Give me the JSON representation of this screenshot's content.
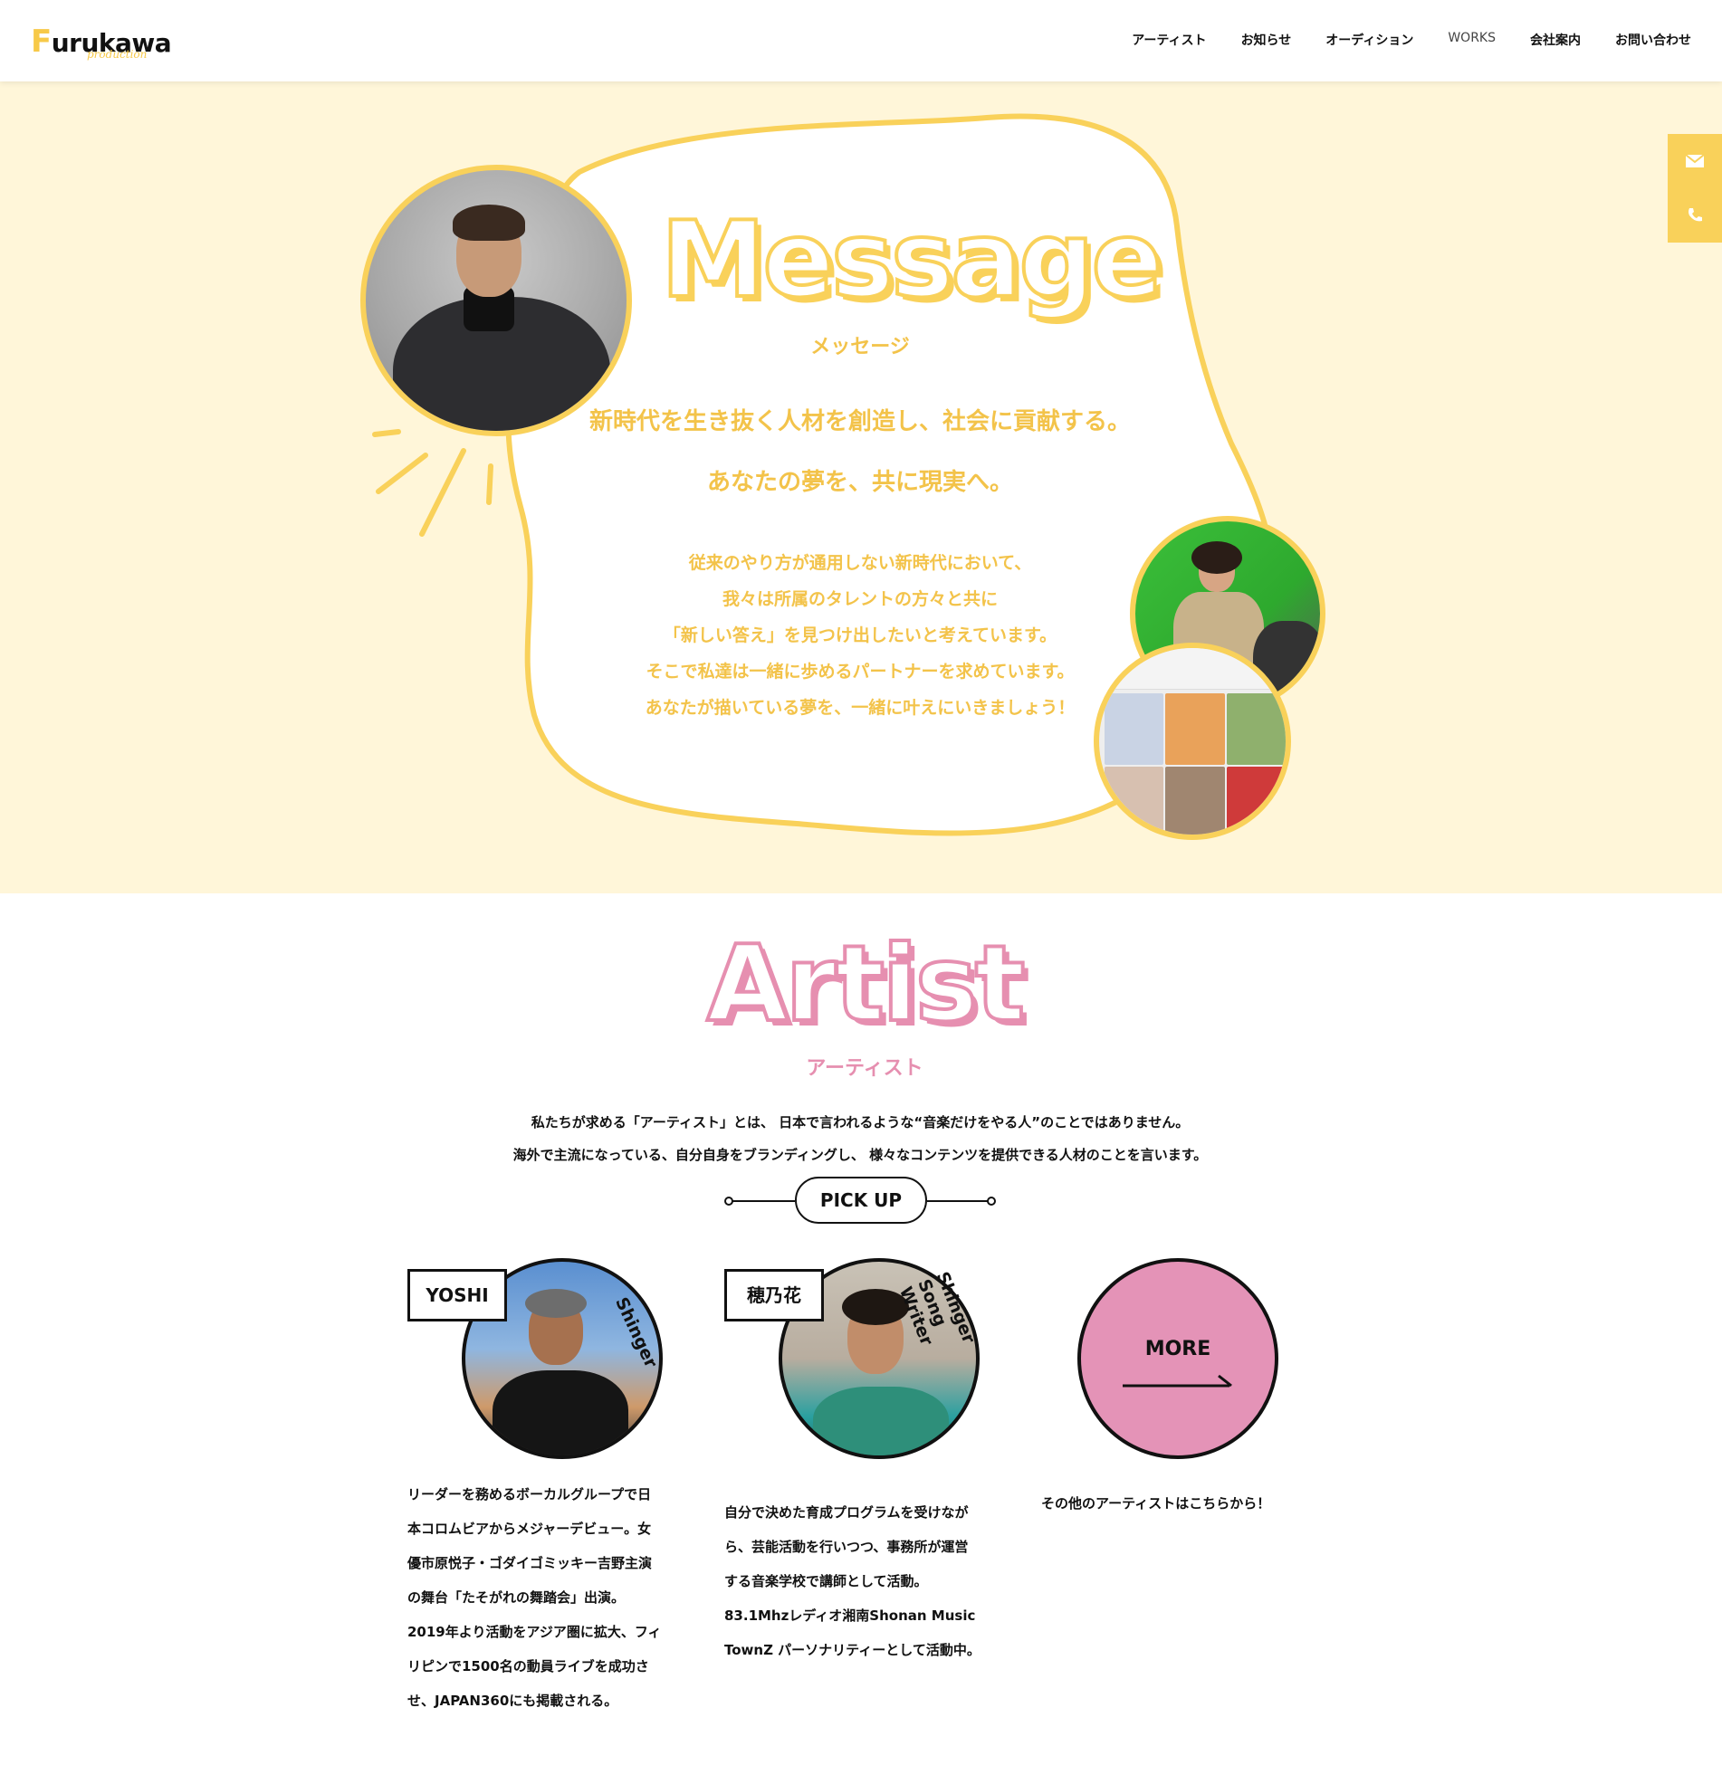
{
  "header": {
    "logo_main": "urukawa",
    "logo_first": "F",
    "logo_sub": "production",
    "nav": [
      "アーティスト",
      "お知らせ",
      "オーディション",
      "WORKS",
      "会社案内",
      "お問い合わせ"
    ]
  },
  "side_tab": {
    "icons": [
      "mail-icon",
      "phone-icon"
    ]
  },
  "message": {
    "title": "Message",
    "subtitle": "メッセージ",
    "lead1": "新時代を生き抜く人材を創造し、社会に貢献する。",
    "lead2": "あなたの夢を、共に現実へ。",
    "body": [
      "従来のやり方が通用しない新時代において、",
      "我々は所属のタレントの方々と共に",
      "「新しい答え」を見つけ出したいと考えています。",
      "そこで私達は一緒に歩めるパートナーを求めています。",
      "あなたが描いている夢を、一緒に叶えにいきましょう！"
    ]
  },
  "artist": {
    "title": "Artist",
    "subtitle": "アーティスト",
    "intro": [
      "私たちが求める「アーティスト」とは、 日本で言われるような“音楽だけをやる人”のことではありません。",
      "海外で主流になっている、自分自身をブランディングし、 様々なコンテンツを提供できる人材のことを言います。"
    ],
    "pickup": "PICK UP",
    "cards": [
      {
        "name": "YOSHI",
        "role": "Shinger",
        "desc": [
          "リーダーを務めるボーカルグループで日",
          "本コロムビアからメジャーデビュー。女",
          "優市原悦子・ゴダイゴミッキー吉野主演",
          "の舞台「たそがれの舞踏会」出演。",
          "2019年より活動をアジア圏に拡大、フィ",
          "リピンで1500名の動員ライブを成功さ",
          "せ、JAPAN360にも掲載される。"
        ]
      },
      {
        "name": "穂乃花",
        "role": "Shinger Song Writer",
        "desc": [
          "自分で決めた育成プログラムを受けなが",
          "ら、芸能活動を行いつつ、事務所が運営",
          "する音楽学校で講師として活動。",
          "83.1Mhzレディオ湘南Shonan Music",
          "TownZ パーソナリティーとして活動中。"
        ]
      }
    ],
    "more_label": "MORE",
    "more_text": "その他のアーティストはこちらから！"
  },
  "colors": {
    "yellow": "#f9d15a",
    "yellow_text": "#f3c34a",
    "cream": "#fff6d9",
    "pink": "#e68fb0",
    "more_pink": "#e493b7"
  }
}
